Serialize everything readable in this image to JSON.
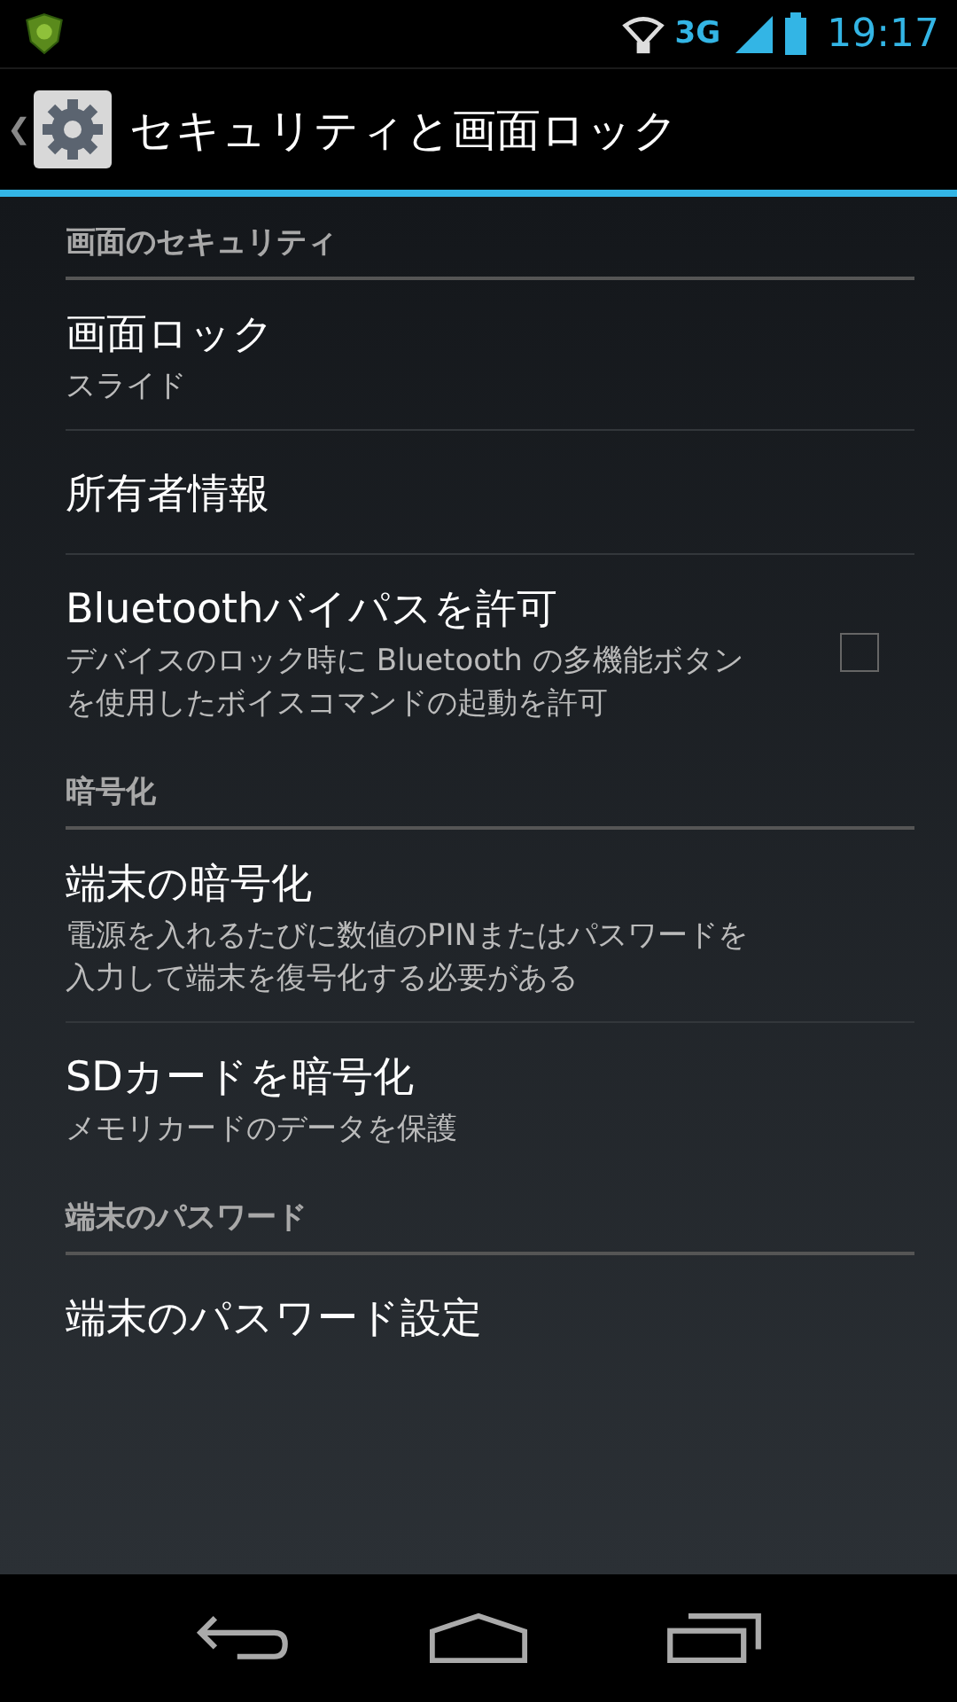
{
  "status_bar": {
    "time": "19:17",
    "network": "3G"
  },
  "action_bar": {
    "back": "❮",
    "title": "セキュリティと画面ロック"
  },
  "sections": [
    {
      "header": "画面のセキュリティ",
      "items": [
        {
          "kind": "plain",
          "title": "画面ロック",
          "summary": "スライド"
        },
        {
          "kind": "plain",
          "title": "所有者情報"
        },
        {
          "kind": "checkbox",
          "title": "Bluetoothバイパスを許可",
          "summary": "デバイスのロック時に Bluetooth の多機能ボタンを使用したボイスコマンドの起動を許可",
          "checked": false
        }
      ]
    },
    {
      "header": "暗号化",
      "items": [
        {
          "kind": "plain",
          "title": "端末の暗号化",
          "summary": "電源を入れるたびに数値のPINまたはパスワードを入力して端末を復号化する必要がある"
        },
        {
          "kind": "plain",
          "title": "SDカードを暗号化",
          "summary": "メモリカードのデータを保護"
        }
      ]
    },
    {
      "header": "端末のパスワード",
      "items": [
        {
          "kind": "plain",
          "title": "端末のパスワード設定"
        }
      ]
    }
  ]
}
